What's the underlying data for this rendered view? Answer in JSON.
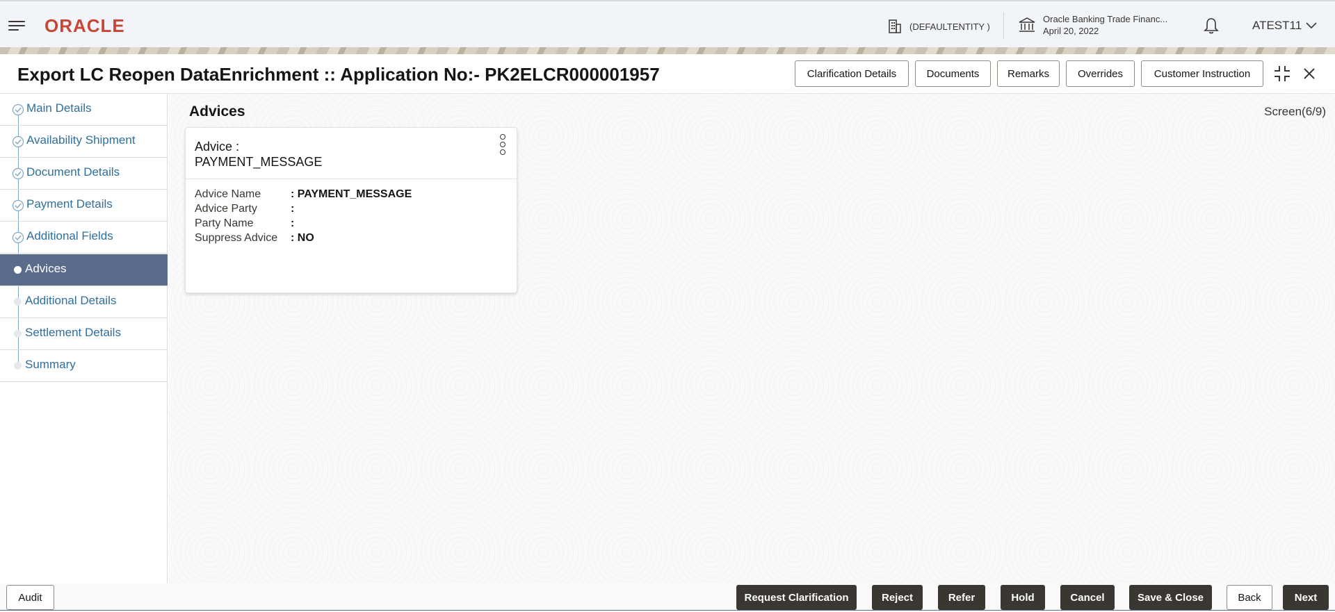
{
  "header": {
    "brand": "ORACLE",
    "entity": "(DEFAULTENTITY )",
    "bank_name": "Oracle Banking Trade Financ...",
    "bank_date": "April 20, 2022",
    "user": "ATEST11"
  },
  "title_bar": {
    "title": "Export LC Reopen DataEnrichment :: Application No:- PK2ELCR000001957",
    "buttons": [
      "Clarification Details",
      "Documents",
      "Remarks",
      "Overrides",
      "Customer Instruction"
    ]
  },
  "sidebar": {
    "items": [
      {
        "label": "Main Details",
        "state": "completed"
      },
      {
        "label": "Availability Shipment",
        "state": "completed"
      },
      {
        "label": "Document Details",
        "state": "completed"
      },
      {
        "label": "Payment Details",
        "state": "completed"
      },
      {
        "label": "Additional Fields",
        "state": "completed"
      },
      {
        "label": "Advices",
        "state": "active"
      },
      {
        "label": "Additional Details",
        "state": "pending"
      },
      {
        "label": "Settlement Details",
        "state": "pending"
      },
      {
        "label": "Summary",
        "state": "pending"
      }
    ]
  },
  "main": {
    "section_title": "Advices",
    "screen_counter": "Screen(6/9)",
    "card": {
      "title_line1": "Advice :",
      "title_line2": "PAYMENT_MESSAGE",
      "fields": [
        {
          "label": "Advice Name",
          "value": ": PAYMENT_MESSAGE"
        },
        {
          "label": "Advice Party",
          "value": ":"
        },
        {
          "label": "Party Name",
          "value": ":"
        },
        {
          "label": "Suppress Advice",
          "value": ": NO"
        }
      ]
    }
  },
  "footer": {
    "audit": "Audit",
    "buttons": [
      "Request Clarification",
      "Reject",
      "Refer",
      "Hold",
      "Cancel",
      "Save & Close",
      "Back",
      "Next"
    ]
  },
  "colors": {
    "brand": "#c74634",
    "nav_active": "#5b6b8c",
    "nav_link": "#2f6f9b",
    "dark_button": "#3a3631"
  },
  "icons": [
    "hamburger-icon",
    "building-icon",
    "bank-icon",
    "bell-icon",
    "chevron-down-icon",
    "check-circle-icon",
    "minimize-icon",
    "close-icon",
    "kebab-icon"
  ]
}
